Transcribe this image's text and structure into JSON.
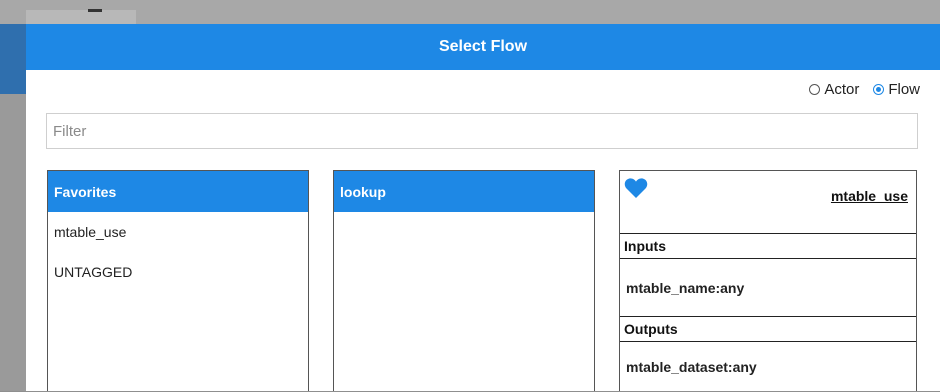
{
  "dialog": {
    "title": "Select Flow"
  },
  "mode": {
    "options": [
      {
        "label": "Actor",
        "selected": false
      },
      {
        "label": "Flow",
        "selected": true
      }
    ]
  },
  "filter": {
    "placeholder": "Filter",
    "value": ""
  },
  "favorites": {
    "header": "Favorites",
    "items": [
      "mtable_use",
      "UNTAGGED"
    ]
  },
  "tags": {
    "header": "lookup",
    "items": []
  },
  "detail": {
    "favorite_icon": "heart-icon",
    "flow_name": "mtable_use",
    "inputs_label": "Inputs",
    "input_value": "mtable_name:any",
    "outputs_label": "Outputs",
    "output_value": "mtable_dataset:any"
  },
  "colors": {
    "accent": "#1e88e5",
    "overlay": "#8f8f8f"
  }
}
